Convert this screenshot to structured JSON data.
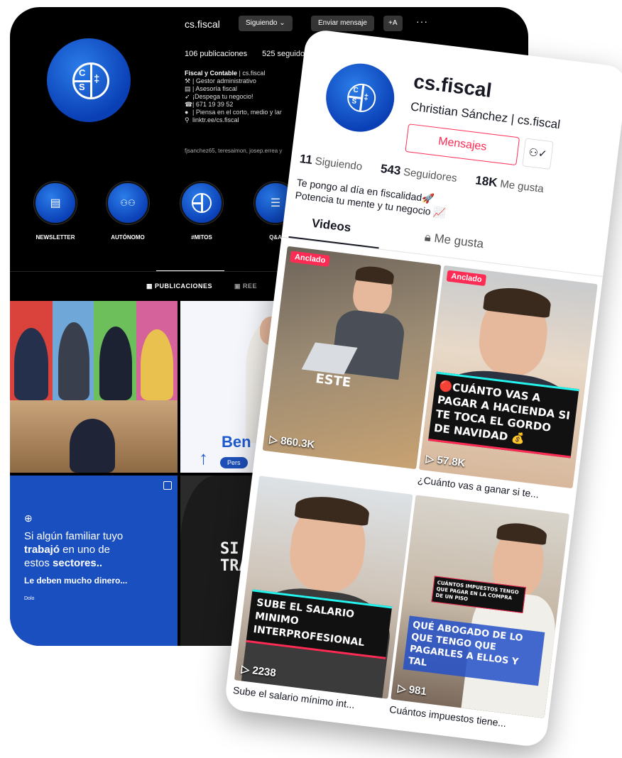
{
  "instagram": {
    "username": "cs.fiscal",
    "buttons": {
      "following": "Siguiendo ⌄",
      "message": "Enviar mensaje",
      "add": "+A",
      "more": "···"
    },
    "stats": {
      "posts": "106 publicaciones",
      "followers": "525 seguidores"
    },
    "bio": {
      "name": "Fiscal y Contable",
      "handle": " | cs.fiscal",
      "lines": [
        "| Gestor administrativo",
        "| Asesoría fiscal",
        "¡Despega tu negocio!",
        "| 671 19 39 52",
        "| Piensa en el corto, medio y lar",
        "linktr.ee/cs.fiscal"
      ]
    },
    "followed_by": "fjsanchez65, teresaimon, josep.errea y",
    "highlights": [
      {
        "label": "NEWSLETTER",
        "icon": "document-icon",
        "glyph": "▤"
      },
      {
        "label": "AUTÓNOMO",
        "icon": "people-icon",
        "glyph": "⚇⚇"
      },
      {
        "label": "#MITOS",
        "icon": "cs-logo-icon",
        "glyph": ""
      },
      {
        "label": "Q&A",
        "icon": "list-icon",
        "glyph": "☰"
      }
    ],
    "tabs": {
      "posts": "PUBLICACIONES",
      "reels": "REE"
    },
    "post_promo": {
      "brand": "Ben",
      "pill": "Pers"
    },
    "post_text": {
      "line1": "Si algún familiar tuyo",
      "line2a": "trabajó",
      "line2b": " en uno de",
      "line3a": "estos ",
      "line3b": "sectores..",
      "line4": "Le deben mucho dinero...",
      "small": "Dolo"
    },
    "post_overlay": {
      "line1": "SI",
      "line2": "TRAB"
    }
  },
  "tiktok": {
    "username": "cs.fiscal",
    "name": "Christian Sánchez | cs.fiscal",
    "message_button": "Mensajes",
    "stats": [
      {
        "value": "11",
        "label": "Siguiendo"
      },
      {
        "value": "543",
        "label": "Seguidores"
      },
      {
        "value": "18K",
        "label": "Me gusta"
      }
    ],
    "bio": [
      "Te pongo al día en fiscalidad🚀",
      "Potencia tu mente y tu negocio 📈"
    ],
    "tabs": {
      "videos": "Videos",
      "likes": "Me gusta"
    },
    "videos": [
      {
        "pinned": "Anclado",
        "views": "▷ 860.3K",
        "overlay": "ESTE",
        "caption": ""
      },
      {
        "pinned": "Anclado",
        "views": "▷ 57.8K",
        "overlay": "🔴CUÁNTO VAS A PAGAR A HACIENDA SI TE TOCA EL GORDO DE NAVIDAD 💰",
        "caption": "¿Cuánto vas a ganar si te..."
      },
      {
        "pinned": "",
        "views": "▷ 2238",
        "overlay": "SUBE EL SALARIO MINIMO INTERPROFESIONAL",
        "caption": "Sube el salario mínimo int..."
      },
      {
        "pinned": "",
        "views": "▷ 981",
        "overlay": "CUÁNTOS IMPUESTOS TENGO QUE PAGAR EN LA COMPRA DE UN PISO",
        "overlay2": "QUÉ ABOGADO DE LO QUE TENGO QUE PAGARLES A ELLOS Y TAL",
        "caption": "Cuántos impuestos tiene..."
      }
    ]
  }
}
